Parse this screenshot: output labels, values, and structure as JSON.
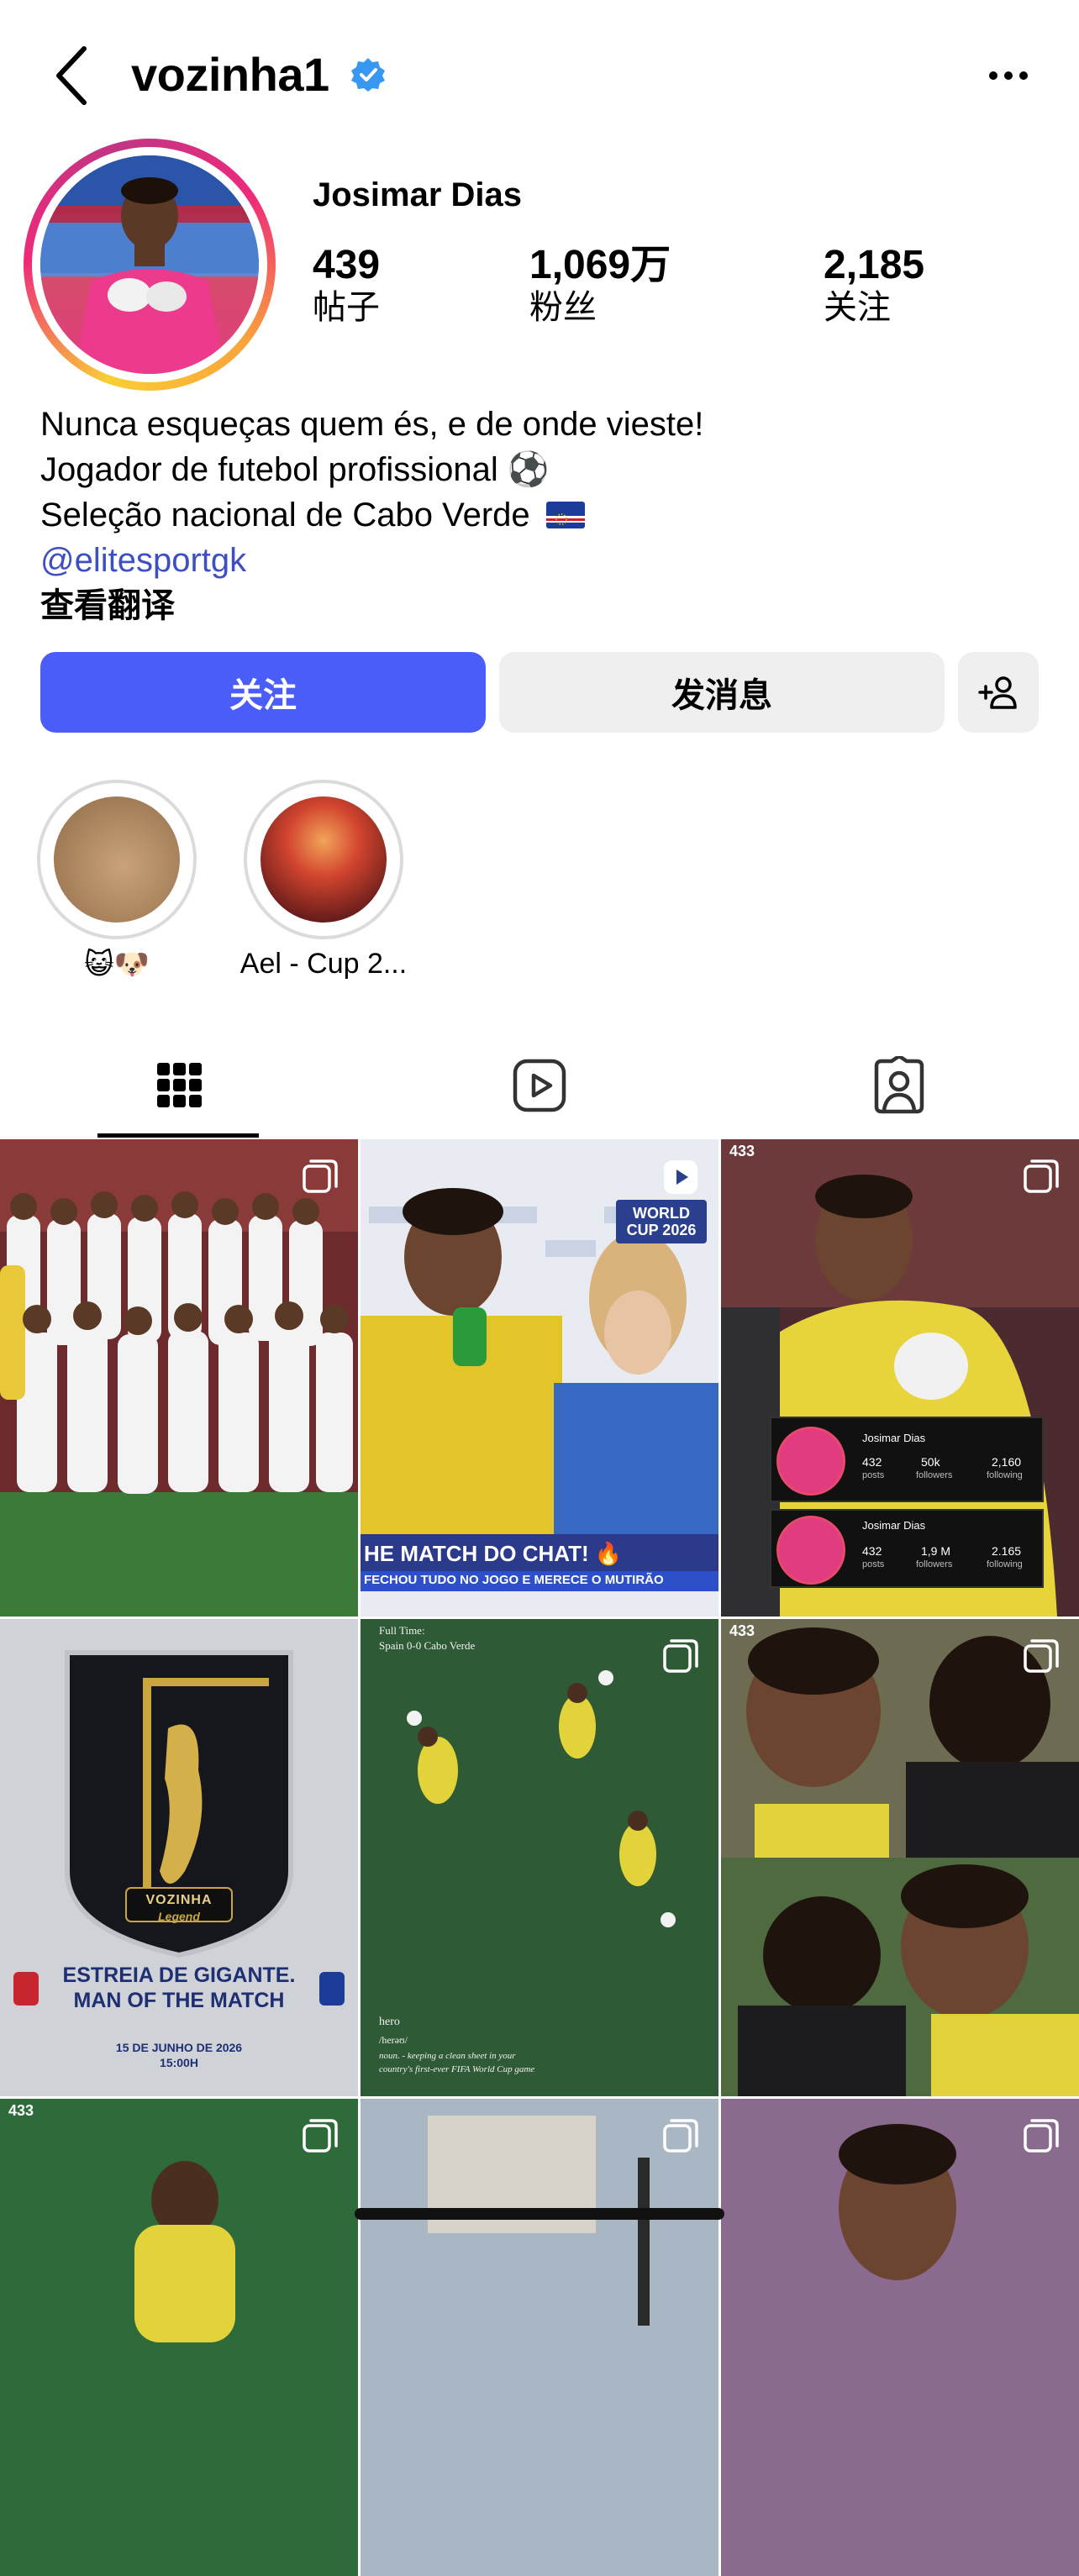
{
  "header": {
    "username": "vozinha1",
    "back_icon": "chevron-left-icon",
    "verified_icon": "verified-badge-icon",
    "more_icon": "more-horizontal-icon"
  },
  "profile": {
    "full_name": "Josimar Dias",
    "stats": [
      {
        "value": "439",
        "label": "帖子"
      },
      {
        "value": "1,069万",
        "label": "粉丝"
      },
      {
        "value": "2,185",
        "label": "关注"
      }
    ],
    "bio": [
      "Nunca esqueças quem és, e de onde vieste!",
      "Jogador de futebol profissional ⚽",
      "Seleção nacional de Cabo Verde"
    ],
    "link": "@elitesportgk",
    "translate": "查看翻译"
  },
  "actions": {
    "follow": "关注",
    "message": "发消息",
    "add_person_icon": "add-person-icon",
    "accent": "#4a5df9"
  },
  "highlights": [
    {
      "label": "😺🐶"
    },
    {
      "label": "Ael - Cup 2..."
    }
  ],
  "tabs": [
    {
      "name": "grid-icon",
      "active": true
    },
    {
      "name": "reels-icon",
      "active": false
    },
    {
      "name": "tagged-icon",
      "active": false
    }
  ],
  "posts": {
    "p2": {
      "badge": "WORLD CUP 2026",
      "ticker_1": "HE MATCH DO CHAT! 🔥",
      "ticker_2": "FECHOU TUDO NO JOGO E MERECE O MUTIRÃO"
    },
    "p3": {
      "brand": "433",
      "card1": {
        "name": "Josimar Dias",
        "posts": "432",
        "posts_l": "posts",
        "followers": "50k",
        "followers_l": "followers",
        "following": "2,160",
        "following_l": "following"
      },
      "card2": {
        "name": "Josimar Dias",
        "posts": "432",
        "posts_l": "posts",
        "followers": "1,9 M",
        "followers_l": "followers",
        "following": "2.165",
        "following_l": "following"
      }
    },
    "p4": {
      "name": "VOZINHA",
      "sub": "Legend",
      "title_1": "ESTREIA DE GIGANTE.",
      "title_2": "MAN OF THE MATCH",
      "date": "15 DE JUNHO DE 2026",
      "time": "15:00H"
    },
    "p5": {
      "top_1": "Full Time:",
      "top_2": "Spain 0-0 Cabo Verde",
      "word": "hero",
      "phon": "/herəʊ/",
      "def_1": "noun. - keeping a clean sheet in your",
      "def_2": "country's first-ever FIFA World Cup game"
    },
    "p6": {
      "brand": "433"
    },
    "p7": {
      "brand": "433"
    }
  }
}
